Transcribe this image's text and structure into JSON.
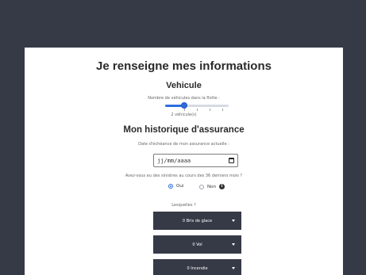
{
  "page": {
    "title": "Je renseigne mes informations",
    "colors": {
      "background": "#363a47",
      "card": "#ffffff",
      "accent": "#2d6cdf"
    }
  },
  "vehicle": {
    "heading": "Vehicule",
    "count_label": "Nombre de véhicules dans la flotte :",
    "count_value": "2 véhicule(s)",
    "slider_fraction": 0.3
  },
  "history": {
    "heading": "Mon historique d'assurance",
    "date_label": "Date d'échéance de mon assurance actuelle :",
    "date_placeholder": "jj/mm/aaaa",
    "date_icon": "calendar-icon",
    "claims_question": "Avez-vous eu des sinistres au cours des 36 derniers mois ?",
    "options": [
      {
        "label": "Oui",
        "selected": true
      },
      {
        "label": "Non",
        "selected": false
      }
    ],
    "info_icon": "info-icon",
    "which_label": "Lesquelles ?",
    "claims": [
      {
        "label": "0 Bris de glace"
      },
      {
        "label": "0 Vol"
      },
      {
        "label": "0 Incendie"
      }
    ]
  }
}
